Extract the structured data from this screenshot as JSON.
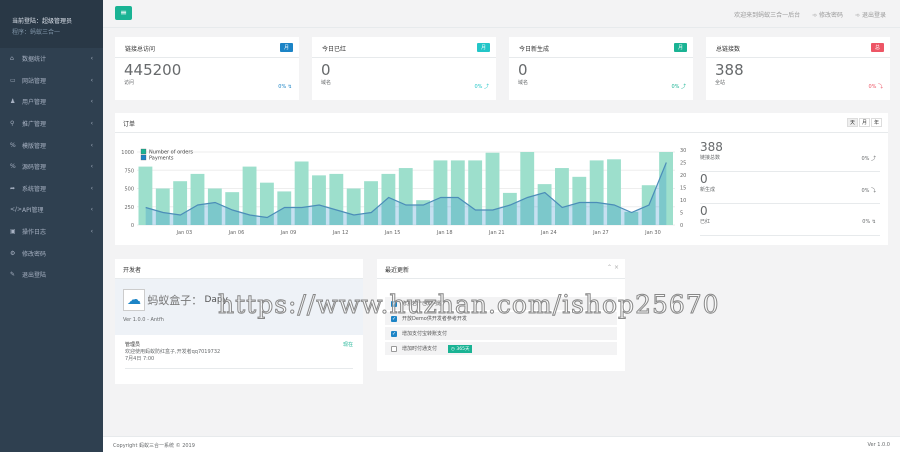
{
  "sidebar": {
    "user_label": "当前登陆：超级管理员",
    "program": "程序：蚂蚁三合一",
    "items": [
      {
        "icon": "home-icon",
        "glyph": "⌂",
        "label": "数据统计"
      },
      {
        "icon": "monitor-icon",
        "glyph": "▭",
        "label": "网站管理"
      },
      {
        "icon": "user-icon",
        "glyph": "♟",
        "label": "用户管理"
      },
      {
        "icon": "share-icon",
        "glyph": "⚲",
        "label": "推广管理"
      },
      {
        "icon": "link-icon",
        "glyph": "%",
        "label": "模版管理"
      },
      {
        "icon": "link-icon",
        "glyph": "%",
        "label": "源码管理"
      },
      {
        "icon": "share-arrow-icon",
        "glyph": "➦",
        "label": "系统管理"
      },
      {
        "icon": "code-icon",
        "glyph": "</>",
        "label": "API管理"
      },
      {
        "icon": "lock-icon",
        "glyph": "▣",
        "label": "操作日志"
      },
      {
        "icon": "gear-icon",
        "glyph": "⚙",
        "label": "修改密码"
      },
      {
        "icon": "pencil-icon",
        "glyph": "✎",
        "label": "退出登陆"
      }
    ]
  },
  "topbar": {
    "welcome": "欢迎来到蚂蚁三合一后台",
    "change_password": "修改密码",
    "logout": "退出登录"
  },
  "cards": [
    {
      "title": "链接总访问",
      "badge": "月",
      "badge_color": "#1c84c6",
      "value": "445200",
      "sub": "访问",
      "pct": "0% ↯",
      "pct_color": "#1c84c6"
    },
    {
      "title": "今日已红",
      "badge": "月",
      "badge_color": "#23c6c8",
      "value": "0",
      "sub": "域名",
      "pct": "0% ⤴",
      "pct_color": "#23c6c8"
    },
    {
      "title": "今日新生成",
      "badge": "月",
      "badge_color": "#1ab394",
      "value": "0",
      "sub": "域名",
      "pct": "0% ⤴",
      "pct_color": "#1ab394"
    },
    {
      "title": "总链接数",
      "badge": "总",
      "badge_color": "#ed5565",
      "value": "388",
      "sub": "全站",
      "pct": "0% ⤵",
      "pct_color": "#ed5565"
    }
  ],
  "orders_panel": {
    "title": "订单",
    "ranges": [
      "天",
      "月",
      "年"
    ],
    "stats": [
      {
        "value": "388",
        "label": "链接总数",
        "pct": "0% ⤴"
      },
      {
        "value": "0",
        "label": "新生成",
        "pct": "0% ⤵"
      },
      {
        "value": "0",
        "label": "已红",
        "pct": "0% ↯"
      }
    ]
  },
  "chart_data": {
    "type": "bar",
    "title": "",
    "x": [
      "Jan 01",
      "Jan 02",
      "Jan 03",
      "Jan 04",
      "Jan 05",
      "Jan 06",
      "Jan 07",
      "Jan 08",
      "Jan 09",
      "Jan 10",
      "Jan 11",
      "Jan 12",
      "Jan 13",
      "Jan 14",
      "Jan 15",
      "Jan 16",
      "Jan 17",
      "Jan 18",
      "Jan 19",
      "Jan 20",
      "Jan 21",
      "Jan 22",
      "Jan 23",
      "Jan 24",
      "Jan 25",
      "Jan 26",
      "Jan 27",
      "Jan 28",
      "Jan 29",
      "Jan 30",
      "Jan 31"
    ],
    "x_ticks": [
      "Jan 03",
      "Jan 06",
      "Jan 09",
      "Jan 12",
      "Jan 15",
      "Jan 18",
      "Jan 21",
      "Jan 24",
      "Jan 27",
      "Jan 30"
    ],
    "series": [
      {
        "name": "Number of orders",
        "type": "bar",
        "axis": "left",
        "color": "#1ab394",
        "values": [
          800,
          500,
          600,
          700,
          500,
          450,
          800,
          580,
          460,
          870,
          680,
          700,
          500,
          600,
          700,
          780,
          340,
          885,
          885,
          885,
          990,
          440,
          1000,
          560,
          780,
          660,
          885,
          900,
          180,
          545,
          1000
        ]
      },
      {
        "name": "Payments",
        "type": "area",
        "axis": "right",
        "color": "#1c84c6",
        "values": [
          7,
          5,
          4,
          8,
          9,
          6,
          4,
          3,
          7,
          7,
          8,
          6,
          4,
          5,
          11,
          8,
          8,
          11,
          11,
          6,
          6,
          8,
          11,
          13,
          7,
          9,
          9,
          8,
          5,
          8,
          25
        ]
      }
    ],
    "left_ticks": [
      0,
      250,
      500,
      750,
      1000
    ],
    "right_ticks": [
      0,
      5,
      10,
      15,
      20,
      25,
      30
    ],
    "ylim_left": [
      0,
      1000
    ],
    "ylim_right": [
      0,
      30
    ],
    "legend": "top-left",
    "grid": true
  },
  "developer": {
    "title": "开发者",
    "product": "蚂蚁盒子：",
    "product_name": "Dapy",
    "version": "Ver 1.0.0 - Antfh",
    "author": "管理员",
    "message": "欢迎使用蚂蚁防红盒子,开发者qq7019732",
    "time": "7月4日 7:00",
    "status": "现在"
  },
  "updates": {
    "title": "最近更新",
    "items": [
      {
        "label": "修复若干已知问题",
        "checked": true
      },
      {
        "label": "开放Demo供开发者参考开发",
        "checked": true
      },
      {
        "label": "增加支付宝转账支付",
        "checked": true
      },
      {
        "label": "增加时付通支付",
        "checked": false,
        "badge": "◷ 365天"
      }
    ]
  },
  "footer": {
    "copyright": "Copyright 蚂蚁三合一系统 © 2019",
    "version": "Ver 1.0.0"
  },
  "watermark": "https://www.huzhan.com/ishop25670"
}
